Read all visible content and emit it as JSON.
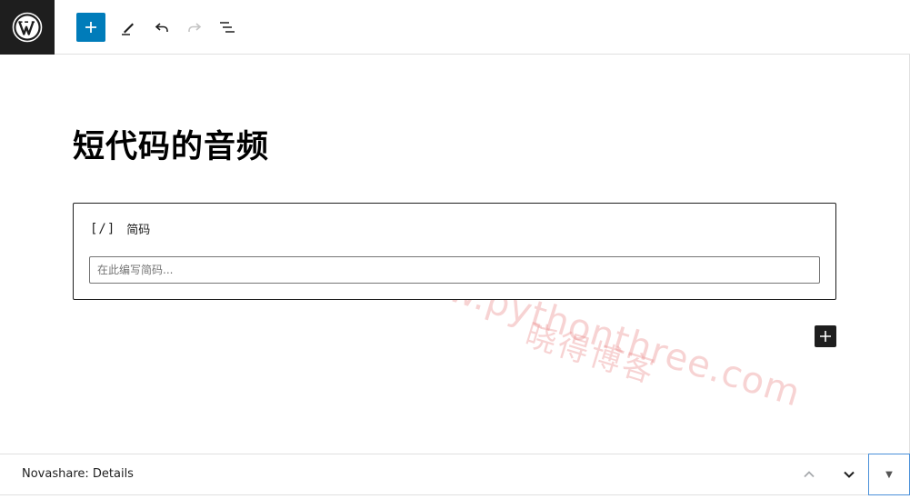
{
  "toolbar": {
    "logo": "wordpress-icon",
    "add_block": "plus-icon",
    "tools": "pencil-icon",
    "undo": "undo-icon",
    "redo": "redo-icon",
    "document_overview": "list-view-icon",
    "accent_color": "#007cba"
  },
  "post": {
    "title": "短代码的音频"
  },
  "shortcode_block": {
    "icon_text": "[/]",
    "label": "简码",
    "input_value": "",
    "input_placeholder": "在此编写简码..."
  },
  "watermark": {
    "url": "https://www.pythonthree.com",
    "name": "晓得博客"
  },
  "metabox": {
    "title": "Novashare: Details",
    "toggle_glyph": "▼"
  }
}
